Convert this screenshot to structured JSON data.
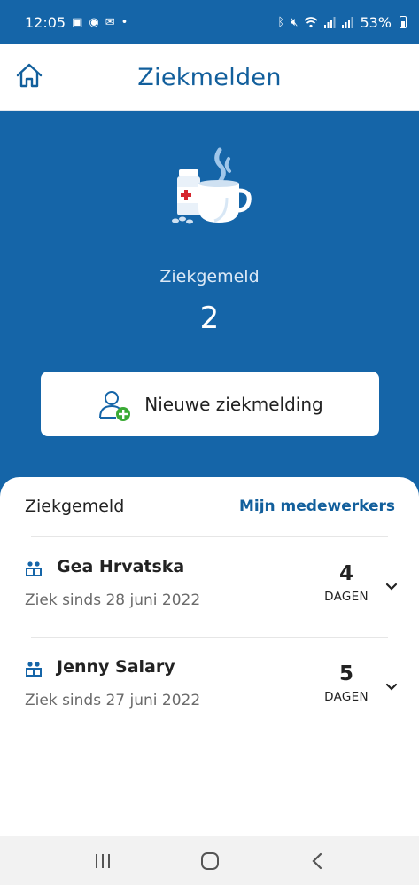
{
  "status_bar": {
    "time": "12:05",
    "battery": "53%",
    "left_icons": [
      "sim-icon",
      "whatsapp-icon",
      "mail-icon",
      "dot-icon"
    ],
    "right_icons": [
      "bluetooth-icon",
      "mute-icon",
      "wifi-icon",
      "signal-icon",
      "signal-icon",
      "battery-icon"
    ]
  },
  "app_bar": {
    "title": "Ziekmelden",
    "home_icon": "home-icon"
  },
  "hero": {
    "illustration": "sick-coffee-medicine-icon",
    "label": "Ziekgemeld",
    "count": "2",
    "button_label": "Nieuwe ziekmelding",
    "button_icon": "add-person-icon"
  },
  "list": {
    "title": "Ziekgemeld",
    "link": "Mijn medewerkers",
    "items": [
      {
        "name": "Gea Hrvatska",
        "since": "Ziek sinds 28 juni 2022",
        "days": "4",
        "days_label": "DAGEN",
        "icon": "team-icon"
      },
      {
        "name": "Jenny Salary",
        "since": "Ziek sinds 27 juni 2022",
        "days": "5",
        "days_label": "DAGEN",
        "icon": "team-icon"
      }
    ]
  },
  "nav_bar": {
    "items": [
      "recent-apps-icon",
      "home-button-icon",
      "back-icon"
    ]
  },
  "colors": {
    "primary": "#1565a8",
    "accent_text": "#125f9c",
    "add_green": "#3aaa35",
    "cross_red": "#d6262d"
  }
}
